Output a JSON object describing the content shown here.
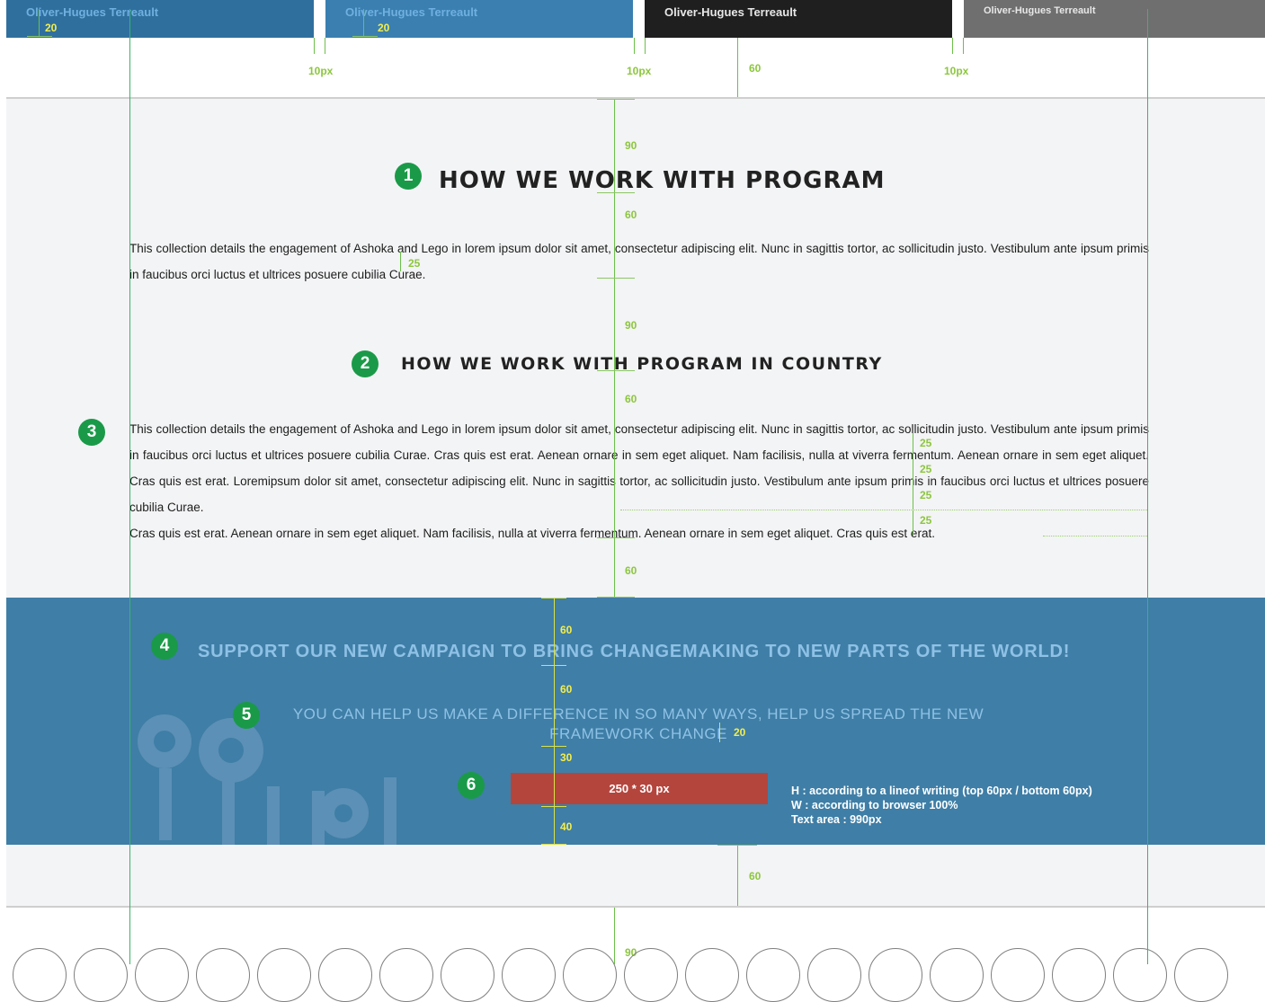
{
  "thumbnails": {
    "captions": [
      "Oliver-Hugues Terreault",
      "Oliver-Hugues Terreault",
      "Oliver-Hugues Terreault",
      "Oliver-Hugues Terreault"
    ]
  },
  "section1": {
    "title": "HOW WE WORK WITH PROGRAM",
    "paragraph": "This collection details the engagement of Ashoka and Lego in lorem ipsum dolor sit amet, consectetur adipiscing elit. Nunc in sagittis tortor, ac sollicitudin justo. Vestibulum ante ipsum primis in faucibus orci luctus et ultrices posuere cubilia Curae."
  },
  "section2": {
    "title": "HOW WE WORK WITH PROGRAM IN COUNTRY",
    "paragraph": "This collection details the engagement of Ashoka and Lego in lorem ipsum dolor sit amet, consectetur adipiscing elit. Nunc in sagittis tortor, ac sollicitudin justo. Vestibulum ante ipsum primis in faucibus orci luctus et ultrices posuere cubilia Curae. Cras quis est erat. Aenean ornare in sem eget aliquet. Nam facilisis, nulla at viverra fermentum. Aenean ornare in sem eget aliquet. Cras quis est erat. Loremipsum dolor sit amet, consectetur adipiscing elit. Nunc in sagittis tortor, ac sollicitudin justo. Vestibulum ante ipsum primis in faucibus orci luctus et ultrices posuere cubilia Curae.",
    "paragraph2": "Cras quis est erat. Aenean ornare in sem eget aliquet. Nam facilisis, nulla at viverra fermentum. Aenean ornare in sem eget aliquet. Cras quis est erat."
  },
  "banner": {
    "title": "SUPPORT OUR NEW CAMPAIGN TO BRING CHANGEMAKING TO NEW PARTS OF THE WORLD!",
    "subtitle": "YOU CAN HELP US MAKE A DIFFERENCE IN SO MANY WAYS, HELP US SPREAD THE NEW FRAMEWORK CHANGE",
    "cta_label": "250 * 30 px",
    "spec_lines": [
      "H :  according to a lineof writing (top 60px / bottom 60px)",
      "W :  according to browser 100%",
      "Text area : 990px"
    ]
  },
  "annotations": {
    "markers": [
      "1",
      "2",
      "3",
      "4",
      "5",
      "6"
    ],
    "spacing": {
      "gap_10px": "10px",
      "v20": "20",
      "v25": "25",
      "v30": "30",
      "v40": "40",
      "v60": "60",
      "v90": "90"
    }
  },
  "colors": {
    "accent_green": "#1a9a48",
    "measure_green": "#8cc63e",
    "banner_blue": "#3f7ea6",
    "cta_red": "#b4453d",
    "light_bg": "#f3f4f5"
  }
}
